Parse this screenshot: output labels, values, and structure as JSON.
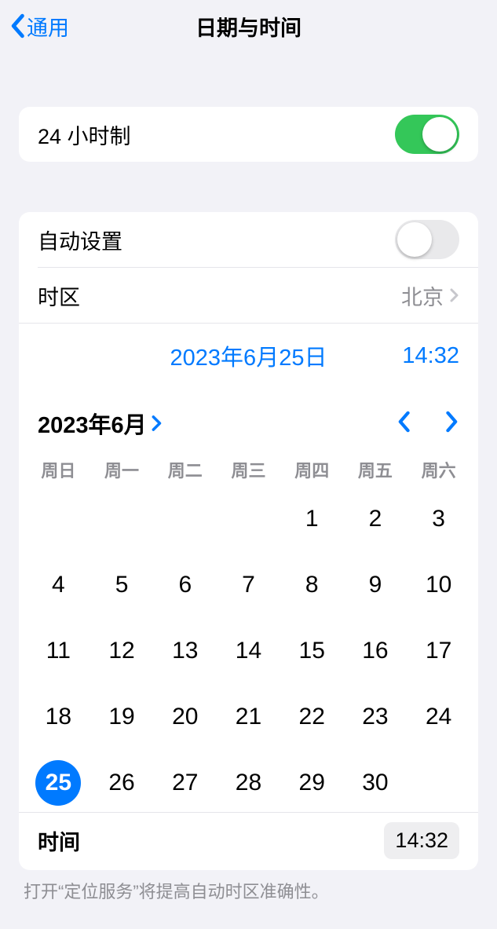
{
  "nav": {
    "back_label": "通用",
    "title": "日期与时间"
  },
  "rows": {
    "hour24": "24 小时制",
    "auto_set": "自动设置",
    "timezone_label": "时区",
    "timezone_value": "北京"
  },
  "switches": {
    "hour24_on": true,
    "auto_set_on": false
  },
  "selected": {
    "date_display": "2023年6月25日",
    "time_display": "14:32"
  },
  "calendar": {
    "month_title": "2023年6月",
    "dow": [
      "周日",
      "周一",
      "周二",
      "周三",
      "周四",
      "周五",
      "周六"
    ],
    "leading_blanks": 4,
    "days": 30,
    "selected_day": 25
  },
  "bottom": {
    "label": "时间",
    "time": "14:32"
  },
  "footer": "打开“定位服务”将提高自动时区准确性。"
}
